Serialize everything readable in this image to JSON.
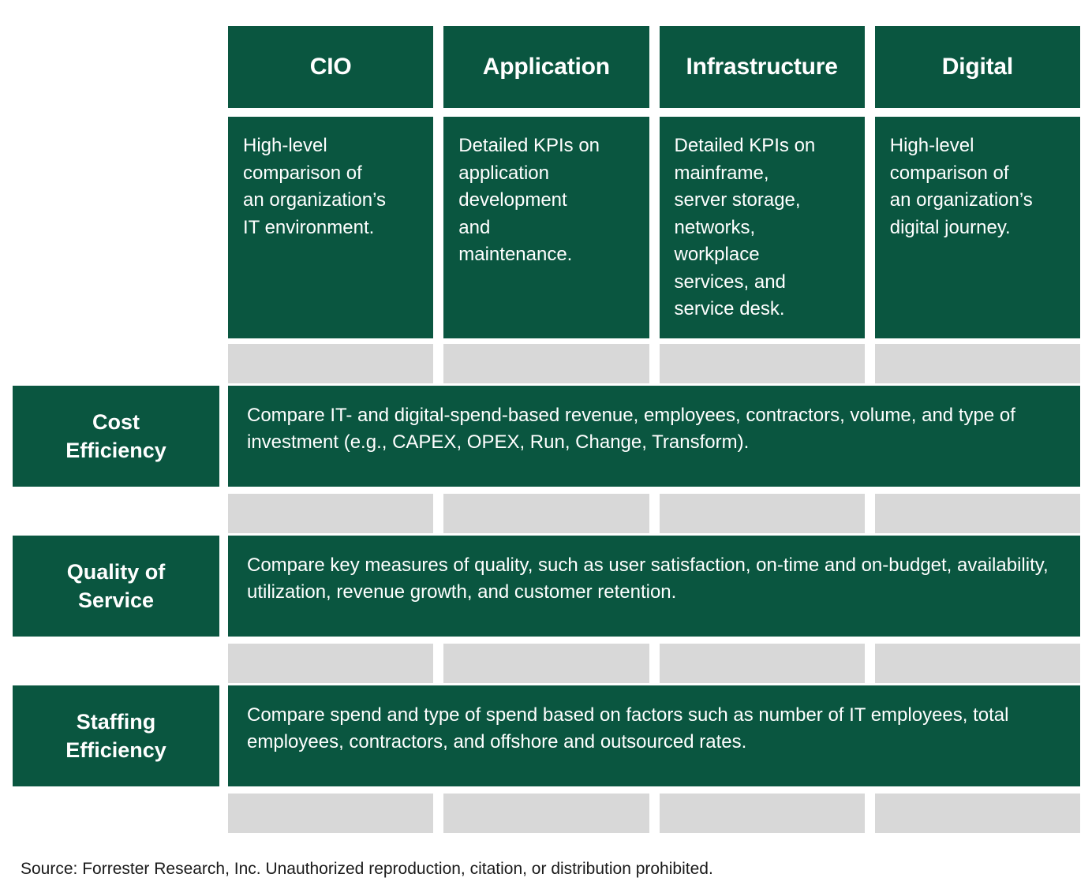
{
  "colors": {
    "green": "#0a5640",
    "gray": "#d8d8d8",
    "white": "#ffffff",
    "text_dark": "#1a1a1a"
  },
  "columns": [
    {
      "header": "CIO",
      "description": "High-level\ncomparison of\nan organization’s\nIT environment."
    },
    {
      "header": "Application",
      "description": "Detailed KPIs on\napplication\ndevelopment\nand\nmaintenance."
    },
    {
      "header": "Infrastructure",
      "description": "Detailed KPIs on\nmainframe,\nserver storage,\nnetworks,\nworkplace\nservices, and\nservice desk."
    },
    {
      "header": "Digital",
      "description": "High-level\ncomparison of\nan organization’s\ndigital journey."
    }
  ],
  "criteria_rows": [
    {
      "label": "Cost\nEfficiency",
      "text": "Compare IT- and digital-spend-based revenue, employees, contractors, volume, and type of investment (e.g., CAPEX, OPEX, Run, Change, Transform)."
    },
    {
      "label": "Quality of\nService",
      "text": "Compare key measures of quality, such as user satisfaction, on-time and on-budget, availability, utilization, revenue growth, and customer retention."
    },
    {
      "label": "Staffing\nEfficiency",
      "text": "Compare spend and type of spend based on factors such as number of IT employees, total employees, contractors, and offshore and outsourced rates."
    }
  ],
  "source_note": "Source: Forrester Research, Inc. Unauthorized reproduction, citation, or distribution prohibited."
}
